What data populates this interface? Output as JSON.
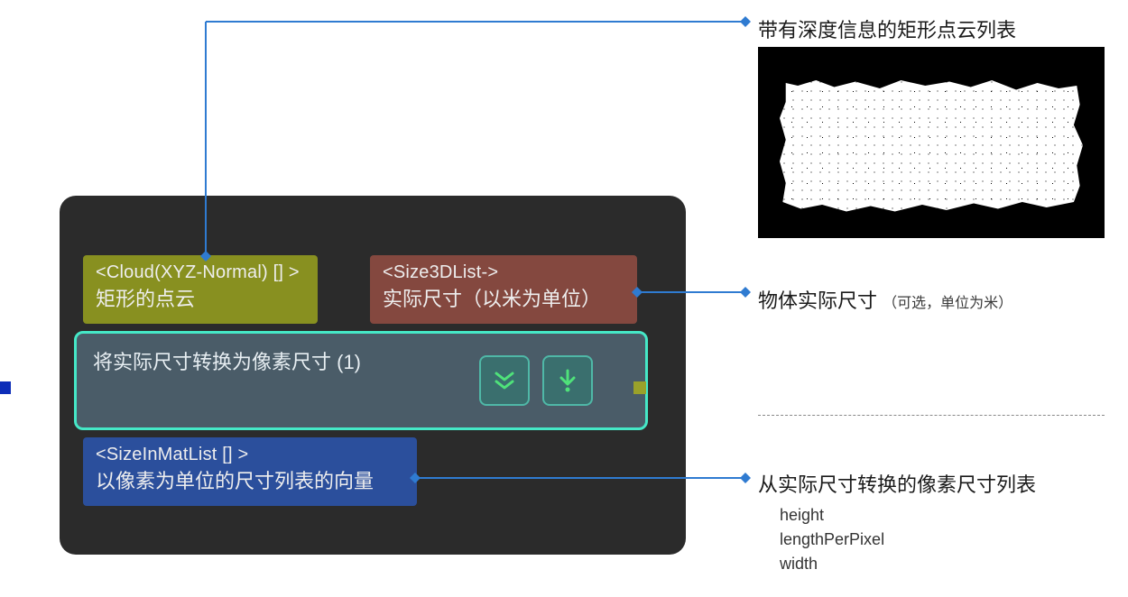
{
  "node": {
    "ports": {
      "cloud": {
        "type": "<Cloud(XYZ-Normal) [] >",
        "desc": "矩形的点云"
      },
      "size3d": {
        "type": "<Size3DList->",
        "desc": "实际尺寸（以米为单位）"
      },
      "sizeinmat": {
        "type": "<SizeInMatList [] >",
        "desc": "以像素为单位的尺寸列表的向量"
      }
    },
    "center_title": "将实际尺寸转换为像素尺寸 (1)"
  },
  "annotations": {
    "pointcloud_label": "带有深度信息的矩形点云列表",
    "actual_size_label": "物体实际尺寸",
    "actual_size_sub": "（可选，单位为米）",
    "pixel_size_label": "从实际尺寸转换的像素尺寸列表",
    "fields": {
      "height": "height",
      "lengthPerPixel": "lengthPerPixel",
      "width": "width"
    }
  }
}
